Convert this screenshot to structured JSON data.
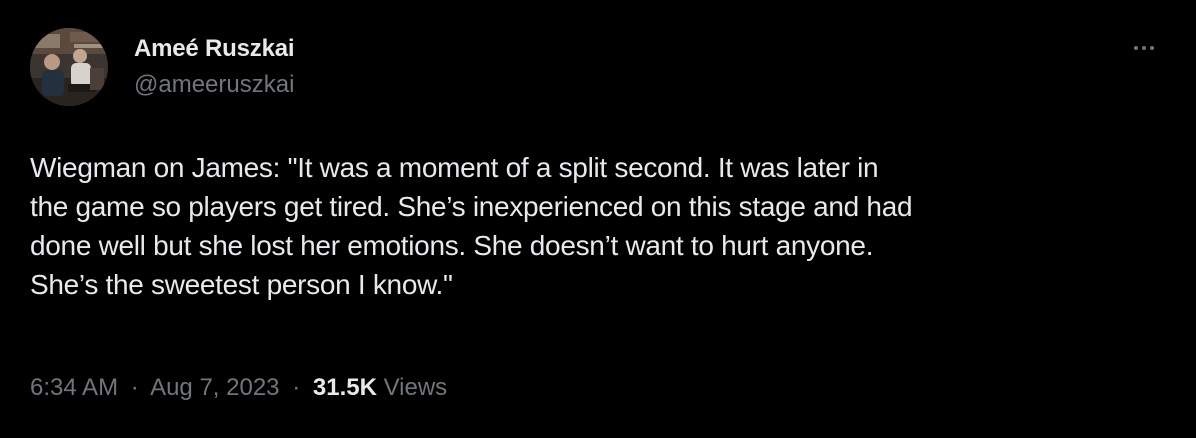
{
  "author": {
    "display_name": "Ameé Ruszkai",
    "handle": "@ameeruszkai",
    "avatar_icon": "profile-photo"
  },
  "more_icon": "more-horizontal-icon",
  "tweet": {
    "text": "Wiegman on James: \"It was a moment of a split second. It was later in\nthe game so players get tired. She’s inexperienced on this stage and had\ndone well but she lost her emotions. She doesn’t want to hurt anyone.\nShe’s the sweetest person I know.\""
  },
  "meta": {
    "time": "6:34 AM",
    "separator": "·",
    "date": "Aug 7, 2023",
    "views_count": "31.5K",
    "views_label": "Views"
  },
  "colors": {
    "background": "#000000",
    "text_primary": "#e7e9ea",
    "text_secondary": "#71767b"
  }
}
